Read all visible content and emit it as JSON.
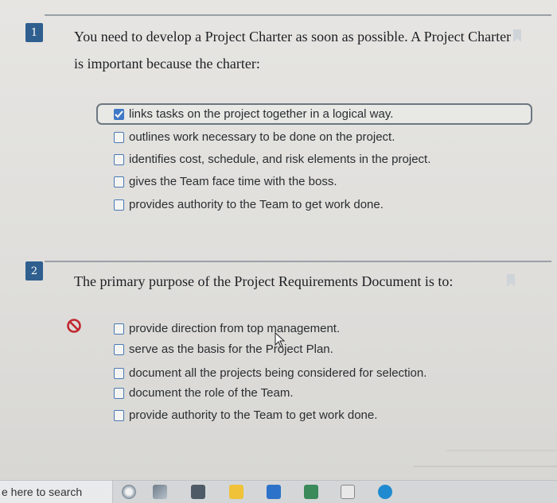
{
  "question1": {
    "number": "1",
    "text_line1": "You need to develop a Project Charter as soon as possible. A Project Charter",
    "text_line2": "is important because the charter:",
    "options": [
      {
        "label": "links tasks on the project together in a logical way.",
        "checked": true
      },
      {
        "label": "outlines work necessary to be done on the project.",
        "checked": false
      },
      {
        "label": "identifies cost, schedule, and risk elements in the project.",
        "checked": false
      },
      {
        "label": "gives the Team face time with the boss.",
        "checked": false
      },
      {
        "label": "provides authority to the Team to get work done.",
        "checked": false
      }
    ]
  },
  "question2": {
    "number": "2",
    "text": "The primary purpose of the Project Requirements Document is to:",
    "status_icon": "not-allowed-icon",
    "options": [
      {
        "label": "provide direction from top management.",
        "checked": false
      },
      {
        "label": "serve as the basis for the Project Plan.",
        "checked": false
      },
      {
        "label": "document all the projects being considered for selection.",
        "checked": false
      },
      {
        "label": "document the role of the Team.",
        "checked": false
      },
      {
        "label": "provide authority to the Team to get work done.",
        "checked": false
      }
    ]
  },
  "taskbar": {
    "search_placeholder": "e here to search",
    "icons": [
      "cortana-icon",
      "task-view-icon",
      "file-explorer-icon",
      "store-icon",
      "mail-icon",
      "app-icon",
      "edge-icon"
    ]
  },
  "colors": {
    "accent": "#3f78c6",
    "badge": "#2f5f8f",
    "error": "#c0282f"
  }
}
